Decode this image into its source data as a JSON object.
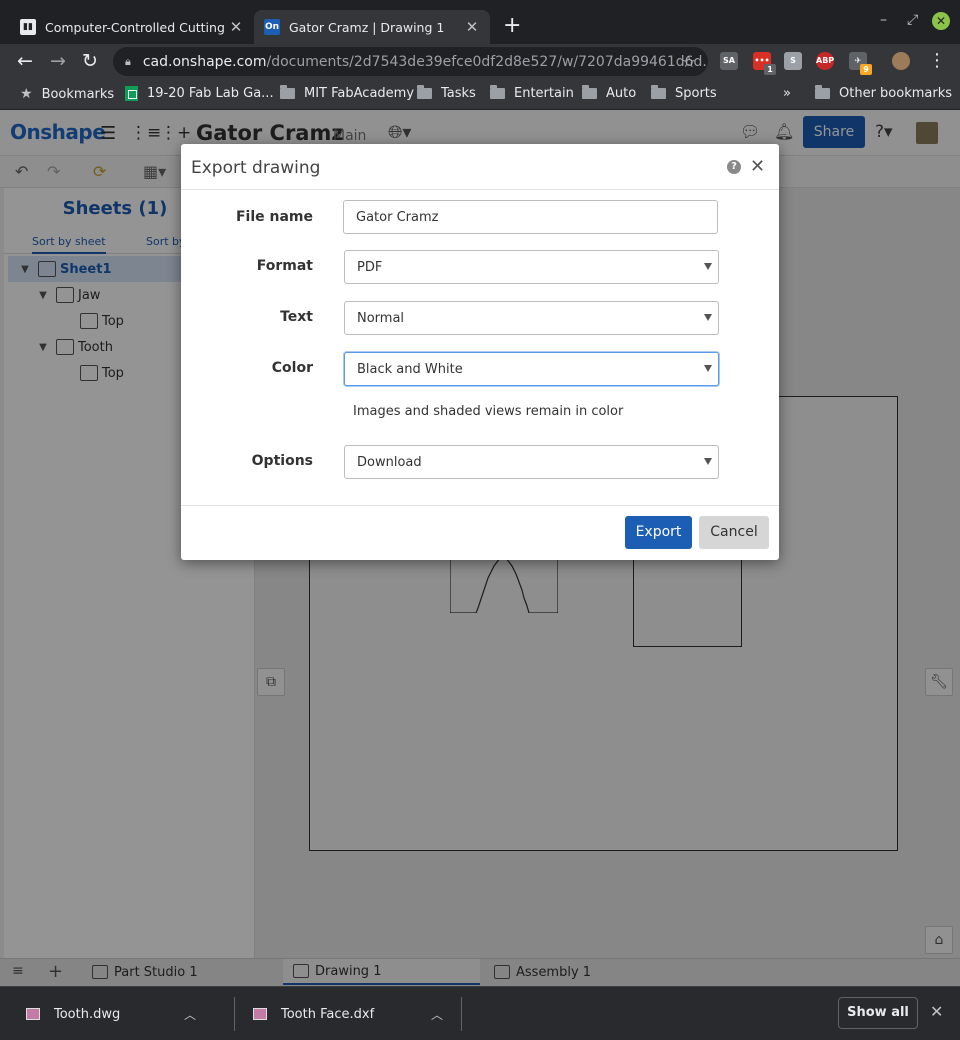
{
  "browser": {
    "tabs": [
      {
        "title": "Computer-Controlled Cutting",
        "favicon": "book-favicon",
        "active": false
      },
      {
        "title": "Gator Cramz | Drawing 1",
        "favicon": "onshape-favicon",
        "favicon_text": "On",
        "active": true
      }
    ],
    "address": {
      "host": "cad.onshape.com",
      "path": "/documents/2d7543de39efce0df2d8e527/w/7207da99461d6d..."
    },
    "extensions": [
      {
        "name": "SA",
        "icon": "sa-extension-icon",
        "color": "#5f6368"
      },
      {
        "name": "•••",
        "icon": "red-extension-icon",
        "badge": "1",
        "color": "#d93025"
      },
      {
        "name": "S",
        "icon": "s-extension-icon",
        "color": "#9aa0a6"
      },
      {
        "name": "ABP",
        "icon": "adblock-icon",
        "color": "#c62828"
      },
      {
        "name": "✈",
        "icon": "plane-extension-icon",
        "badge": "9",
        "color": "#5f6368"
      }
    ],
    "bookmarks": [
      {
        "label": "Bookmarks",
        "icon": "star-icon"
      },
      {
        "label": "19-20 Fab Lab Ga...",
        "icon": "sheets-icon"
      },
      {
        "label": "MIT FabAcademy",
        "icon": "folder-icon"
      },
      {
        "label": "Tasks",
        "icon": "folder-icon"
      },
      {
        "label": "Entertain",
        "icon": "folder-icon"
      },
      {
        "label": "Auto",
        "icon": "folder-icon"
      },
      {
        "label": "Sports",
        "icon": "folder-icon"
      }
    ],
    "bookmarks_overflow": "»",
    "other_bookmarks": "Other bookmarks"
  },
  "app": {
    "logo": "Onshape",
    "doc_title": "Gator Cramz",
    "branch": "Main",
    "share_label": "Share",
    "sheets_title": "Sheets (1)",
    "sort_tabs": [
      "Sort by sheet",
      "Sort by"
    ],
    "tree": [
      {
        "label": "Sheet1",
        "level": 0,
        "selected": true
      },
      {
        "label": "Jaw",
        "level": 1
      },
      {
        "label": "Top",
        "level": 2
      },
      {
        "label": "Tooth",
        "level": 1
      },
      {
        "label": "Top",
        "level": 2
      }
    ],
    "bottom_tabs": [
      {
        "label": "Part Studio 1"
      },
      {
        "label": "Drawing 1",
        "active": true
      },
      {
        "label": "Assembly 1"
      }
    ],
    "accent_color": "#1d5eb5"
  },
  "dialog": {
    "title": "Export drawing",
    "fields": {
      "file_name": {
        "label": "File name",
        "value": "Gator Cramz"
      },
      "format": {
        "label": "Format",
        "value": "PDF"
      },
      "text": {
        "label": "Text",
        "value": "Normal"
      },
      "color": {
        "label": "Color",
        "value": "Black and White"
      },
      "options": {
        "label": "Options",
        "value": "Download"
      }
    },
    "color_note": "Images and shaded views remain in color",
    "export_label": "Export",
    "cancel_label": "Cancel"
  },
  "downloads": {
    "items": [
      {
        "name": "Tooth.dwg"
      },
      {
        "name": "Tooth Face.dxf"
      }
    ],
    "show_all": "Show all"
  }
}
